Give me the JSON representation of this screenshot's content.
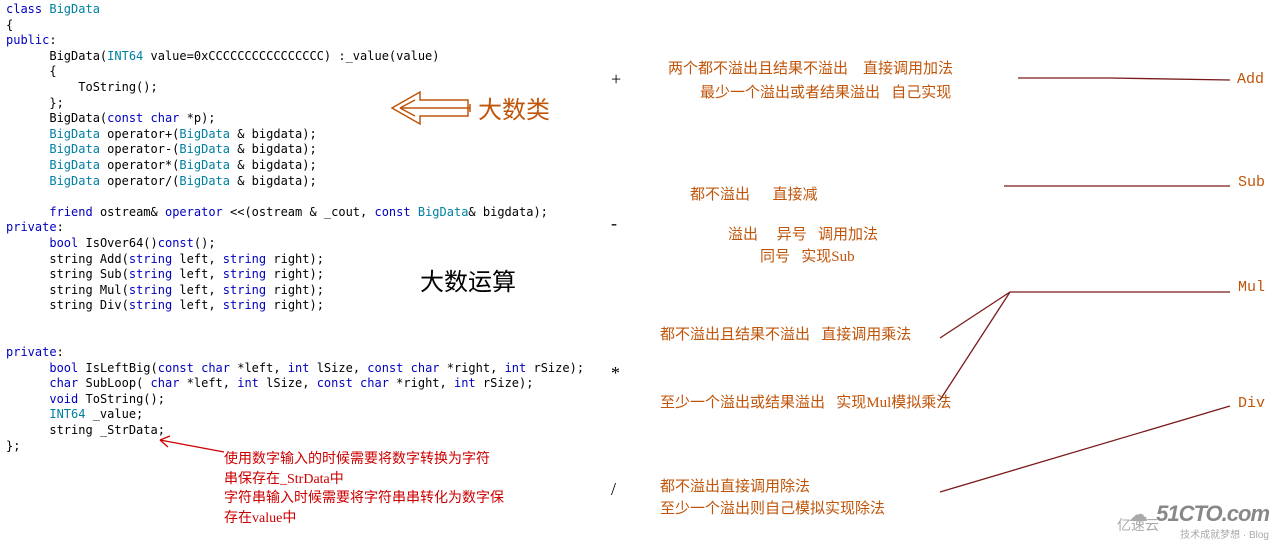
{
  "code": {
    "l1": "class",
    "l1b": "BigData",
    "l2": "{",
    "l3": "public",
    "l3b": ":",
    "l4a": "BigData(",
    "l4b": "INT64",
    "l4c": " value=0xCCCCCCCCCCCCCCCC) :_value(value)",
    "l5": "{",
    "l6": "ToString();",
    "l7": "};",
    "l8a": "BigData(",
    "l8b": "const char",
    "l8c": " *p);",
    "l9a": "BigData",
    "l9b": " operator+(",
    "l9c": "BigData",
    "l9d": " & bigdata);",
    "l10a": "BigData",
    "l10b": " operator-(",
    "l10c": "BigData",
    "l10d": " & bigdata);",
    "l11a": "BigData",
    "l11b": " operator*(",
    "l11c": "BigData",
    "l11d": " & bigdata);",
    "l12a": "BigData",
    "l12b": " operator/(",
    "l12c": "BigData",
    "l12d": " & bigdata);",
    "l13a": "friend",
    "l13b": " ostream& ",
    "l13c": "operator",
    "l13d": " <<(ostream & _cout, ",
    "l13e": "const",
    "l13f": " ",
    "l13g": "BigData",
    "l13h": "& bigdata);",
    "l14": "private",
    "l14b": ":",
    "l15a": "bool",
    "l15b": " IsOver64()",
    "l15c": "const",
    "l15d": "();",
    "l16a": "string Add(",
    "l16b": "string",
    "l16c": " left, ",
    "l16d": "string",
    "l16e": " right);",
    "l17a": "string Sub(",
    "l18a": "string Mul(",
    "l19a": "string Div(",
    "l20": "private",
    "l20b": ":",
    "l21a": "bool",
    "l21b": " IsLeftBig(",
    "l21c": "const char",
    "l21d": " *left, ",
    "l21e": "int",
    "l21f": " lSize, ",
    "l21g": "const char",
    "l21h": " *right, ",
    "l21i": "int",
    "l21j": " rSize);",
    "l22a": "char",
    "l22b": " SubLoop( ",
    "l22c": "char",
    "l22d": " *left, ",
    "l22e": "int",
    "l22f": " lSize, ",
    "l22g": "const char",
    "l22h": " *right, ",
    "l22i": "int",
    "l22j": " rSize);",
    "l23a": "void",
    "l23b": " ToString();",
    "l24a": "INT64",
    "l24b": " _value;",
    "l25a": "string _StrData;",
    "l26": "};"
  },
  "labels": {
    "bigdata_class": "大数类",
    "bigdata_calc": "大数运算"
  },
  "red_note": "使用数字输入的时候需要将数字转换为字符\n串保存在_StrData中\n字符串输入时候需要将字符串串转化为数字保\n存在value中",
  "ops": {
    "plus": "+",
    "minus": "-",
    "mul": "*",
    "div": "/",
    "add_label": "Add",
    "sub_label": "Sub",
    "mul_label": "Mul",
    "div_label": "Div",
    "add_line1": "两个都不溢出且结果不溢出    直接调用加法",
    "add_line2": "最少一个溢出或者结果溢出   自己实现",
    "sub_line1": "都不溢出      直接减",
    "sub_line2": "溢出     异号   调用加法",
    "sub_line3": "同号   实现Sub",
    "mul_line1": "都不溢出且结果不溢出   直接调用乘法",
    "mul_line2": "至少一个溢出或结果溢出   实现Mul模拟乘法",
    "div_line1": "都不溢出直接调用除法",
    "div_line2": "至少一个溢出则自己模拟实现除法"
  },
  "footer": {
    "brand": "51CTO.com",
    "sub": "技术成就梦想 · Blog",
    "left": "亿速云"
  }
}
